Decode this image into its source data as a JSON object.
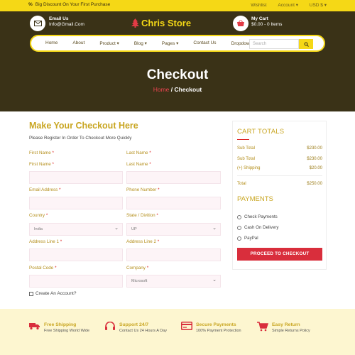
{
  "topbar": {
    "promo_icon": "%",
    "promo_text": "Big Discount On Your First Purchase",
    "links": [
      "Wishlist",
      "Account ▾",
      "USD $ ▾"
    ]
  },
  "header": {
    "email_label": "Email Us",
    "email_value": "Info@Gmail.Com",
    "logo_text": "Chris Store",
    "cart_label": "My Cart",
    "cart_value": "$0.00 - 0 Items"
  },
  "nav": {
    "items": [
      "Home",
      "About",
      "Product ▾",
      "Blog ▾",
      "Pages ▾",
      "Contact Us",
      "Dropdown ▾"
    ],
    "search_placeholder": "Search"
  },
  "hero": {
    "title": "Checkout",
    "breadcrumb_home": "Home",
    "breadcrumb_sep": " / ",
    "breadcrumb_current": "Checkout"
  },
  "form": {
    "title": "Make Your Checkout Here",
    "subtitle": "Please Register In Order To Checkout More Quickly",
    "first_name": "First Name",
    "last_name": "Last Name",
    "email": "Email Address",
    "phone": "Phone Number",
    "country": "Country",
    "state": "State / Divition",
    "country_value": "India",
    "state_value": "UP",
    "addr1": "Address Line 1",
    "addr2": "Address Line 2",
    "postal": "Postal Code",
    "company": "Company",
    "company_value": "Microsoft",
    "req": "*",
    "create_account": "Create An Account?"
  },
  "cart": {
    "title": "CART TOTALS",
    "rows": [
      {
        "label": "Sub Total",
        "value": "$230.00"
      },
      {
        "label": "Sub Total",
        "value": "$230.00"
      },
      {
        "label": "(+) Shipping",
        "value": "$20.00"
      }
    ],
    "total_label": "Total",
    "total_value": "$250.00",
    "payments_title": "PAYMENTS",
    "payments": [
      "Check Payments",
      "Cash On Delivery",
      "PayPal"
    ],
    "proceed": "PROCEED TO CHECKOUT"
  },
  "features": [
    {
      "title": "Free Shipping",
      "sub": "Free Shipping World Wide",
      "icon": "truck-icon"
    },
    {
      "title": "Support 24/7",
      "sub": "Contact Us 24 Hours A Day",
      "icon": "headset-icon"
    },
    {
      "title": "Secure Payments",
      "sub": "100% Payment Protection",
      "icon": "card-icon"
    },
    {
      "title": "Easy Return",
      "sub": "Simple Returns Policy",
      "icon": "cart-icon"
    }
  ],
  "colors": {
    "accent": "#f5d816",
    "header_bg": "#3a3217",
    "brand_red": "#d92e3c",
    "label": "#b38d18"
  }
}
